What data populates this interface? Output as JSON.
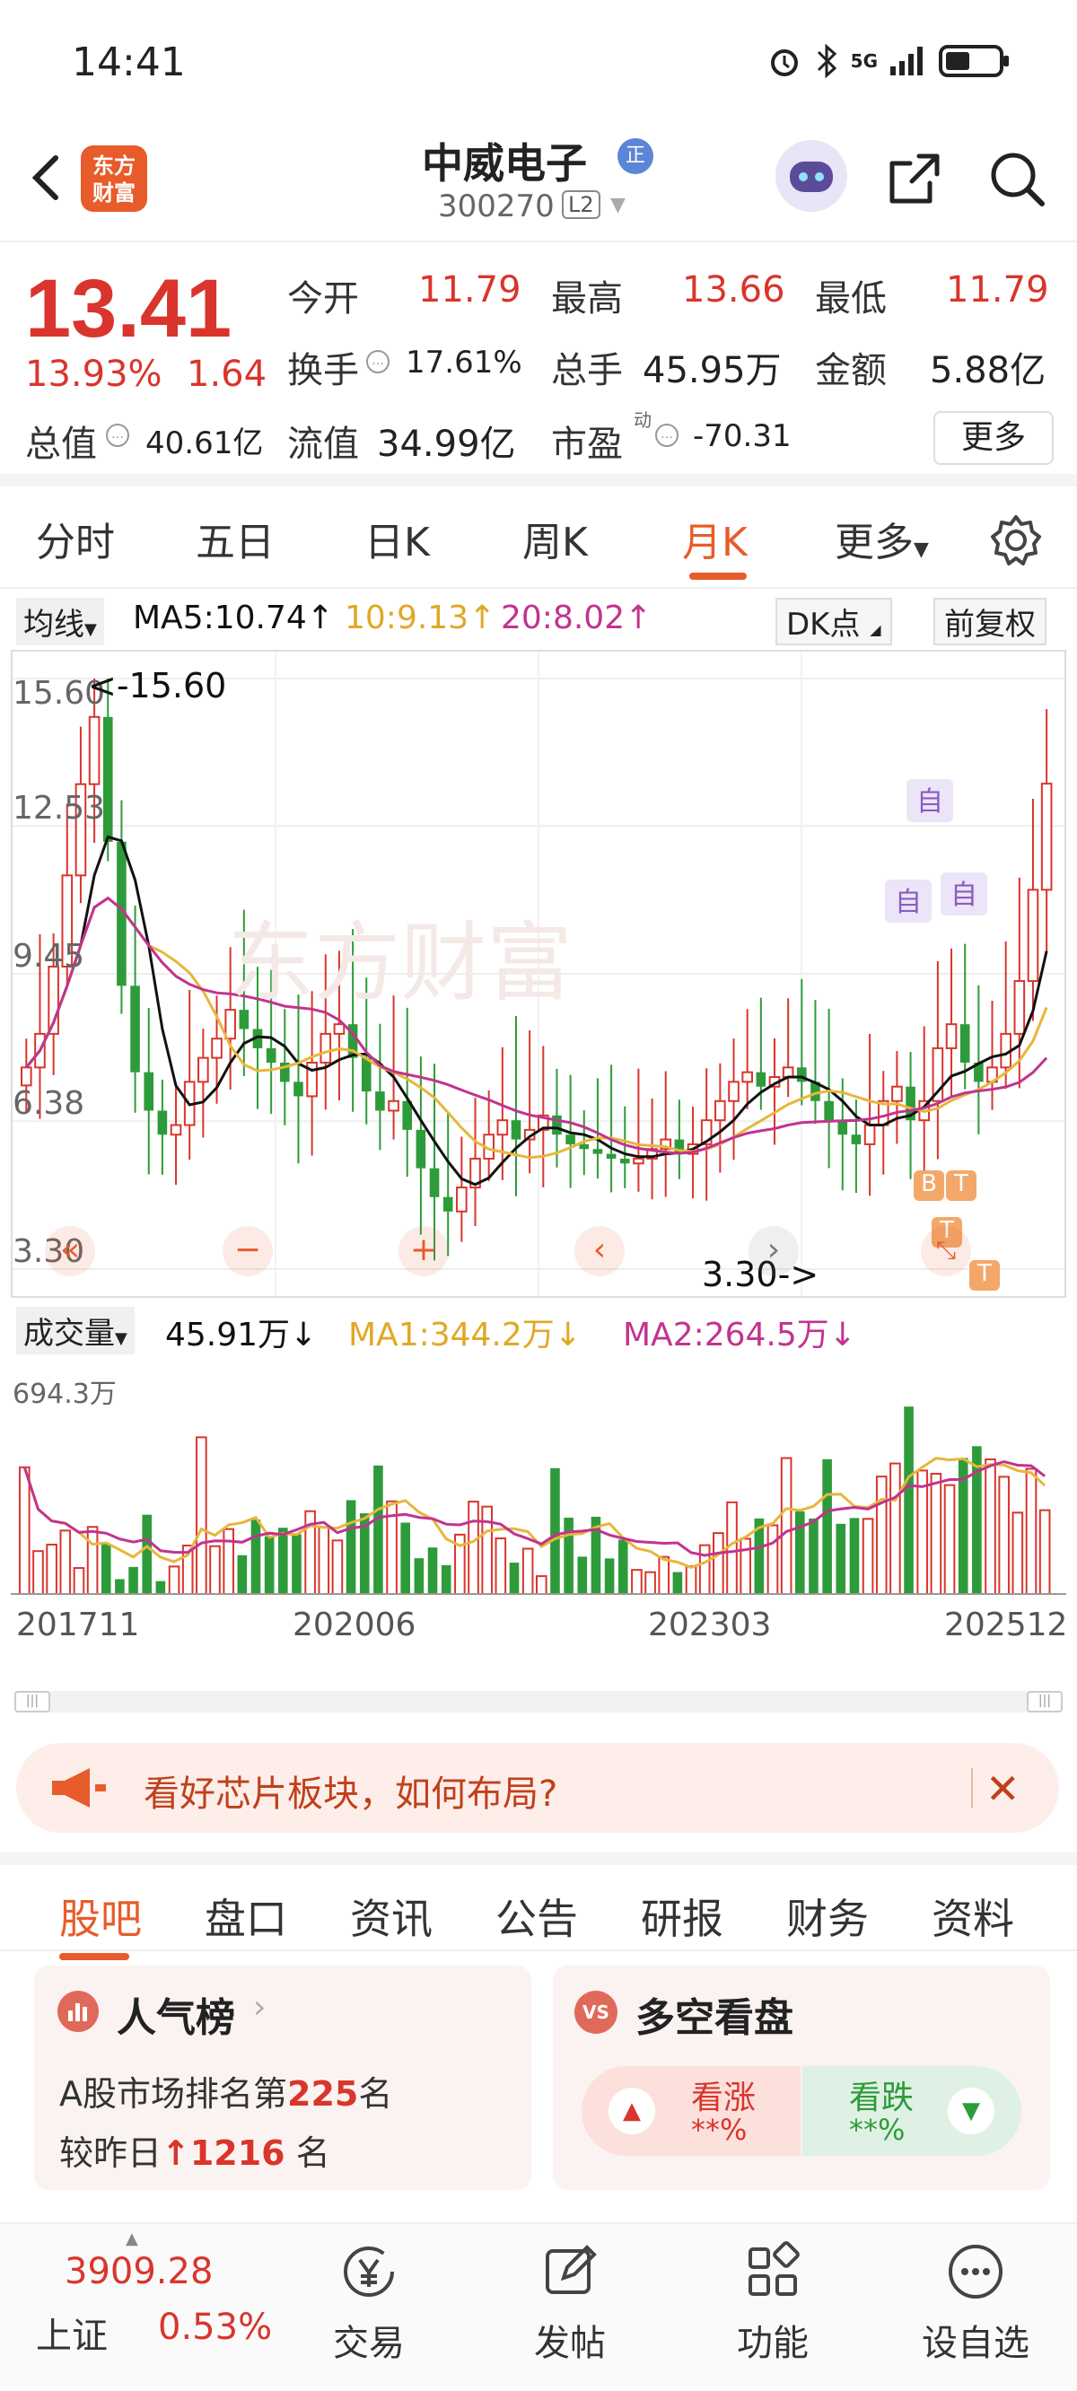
{
  "status_bar": {
    "time": "14:41",
    "network": "5G"
  },
  "header": {
    "logo_text_1": "东方",
    "logo_text_2": "财富",
    "stock_name": "中威电子",
    "badge": "正",
    "stock_code": "300270",
    "level_badge": "L2"
  },
  "quote": {
    "price": "13.41",
    "change_pct": "13.93%",
    "change_abs": "1.64",
    "open_label": "今开",
    "open": "11.79",
    "high_label": "最高",
    "high": "13.66",
    "low_label": "最低",
    "low": "11.79",
    "turnover_label": "换手",
    "turnover": "17.61%",
    "volume_label": "总手",
    "volume": "45.95万",
    "amount_label": "金额",
    "amount": "5.88亿",
    "mktcap_label": "总值",
    "mktcap": "40.61亿",
    "float_label": "流值",
    "float": "34.99亿",
    "pe_label": "市盈",
    "pe_sup": "动",
    "pe": "-70.31",
    "more": "更多"
  },
  "chart_tabs": [
    "分时",
    "五日",
    "日K",
    "周K",
    "月K",
    "更多"
  ],
  "active_chart_tab": "月K",
  "ma_legend": {
    "selector": "均线",
    "ma5": "MA5:10.74↑",
    "ma10": "10:9.13↑",
    "ma20": "20:8.02↑",
    "dk": "DK点",
    "adjust": "前复权"
  },
  "price_axis": [
    "15.60",
    "12.53",
    "9.45",
    "6.38",
    "3.30"
  ],
  "annotations": {
    "high": "<-15.60",
    "low": "3.30->"
  },
  "markers": {
    "zi": "自",
    "b": "B",
    "t": "T"
  },
  "volume_legend": {
    "selector": "成交量",
    "vol": "45.91万↓",
    "ma1": "MA1:344.2万↓",
    "ma2": "MA2:264.5万↓",
    "max": "694.3万"
  },
  "dates": [
    "201711",
    "202006",
    "202303",
    "202512"
  ],
  "colors": {
    "up": "#d9352c",
    "down": "#2e9b3a",
    "ma5": "#111111",
    "ma10": "#e8b63b",
    "ma20": "#c2338f",
    "brand": "#e85b2a"
  },
  "banner": {
    "text": "看好芯片板块，如何布局?"
  },
  "forum_tabs": [
    "股吧",
    "盘口",
    "资讯",
    "公告",
    "研报",
    "财务",
    "资料"
  ],
  "active_forum_tab": "股吧",
  "popularity": {
    "title": "人气榜",
    "line1_prefix": "A股市场排名第",
    "rank": "225",
    "line1_suffix": "名",
    "line2_prefix": "较昨日",
    "delta": "1216",
    "line2_suffix": " 名"
  },
  "sentiment": {
    "title": "多空看盘",
    "badge": "VS",
    "up_label": "看涨",
    "up_value": "**%",
    "down_label": "看跌",
    "down_value": "**%"
  },
  "bottom": {
    "index_value": "3909.28",
    "index_name": "上证",
    "index_change": "0.53%",
    "nav": [
      "交易",
      "发帖",
      "功能",
      "设自选"
    ]
  },
  "chart_data": {
    "type": "candlestick",
    "title": "",
    "ylim": [
      3.3,
      15.6
    ],
    "y_ticks": [
      15.6,
      12.53,
      9.45,
      6.38,
      3.3
    ],
    "x_tick_labels": [
      "201711",
      "202006",
      "202303",
      "202512"
    ],
    "ma5": 10.74,
    "ma10": 9.13,
    "ma20": 8.02,
    "last_close": 13.41,
    "period_high": 15.6,
    "period_low": 3.3,
    "volume_max": "694.3万",
    "volume_last": "45.91万",
    "volume_ma1": "344.2万",
    "volume_ma2": "264.5万"
  }
}
